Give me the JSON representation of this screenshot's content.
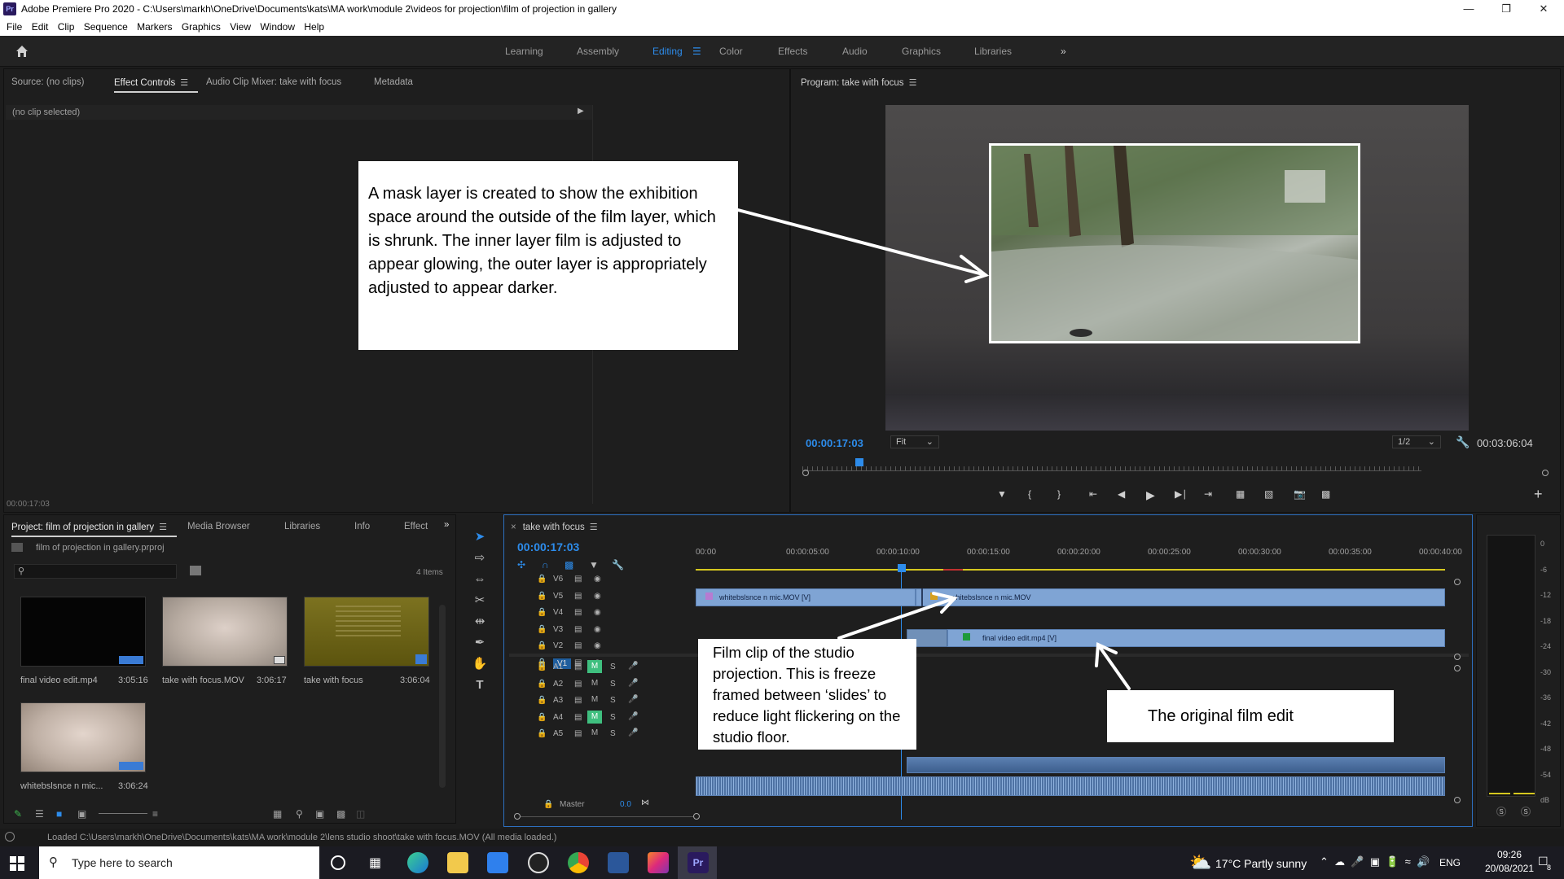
{
  "window": {
    "title": "Adobe Premiere Pro 2020 - C:\\Users\\markh\\OneDrive\\Documents\\kats\\MA work\\module 2\\videos for projection\\film of projection in gallery",
    "app_badge": "Pr"
  },
  "menu": [
    "File",
    "Edit",
    "Clip",
    "Sequence",
    "Markers",
    "Graphics",
    "View",
    "Window",
    "Help"
  ],
  "workspaces": [
    "Learning",
    "Assembly",
    "Editing",
    "Color",
    "Effects",
    "Audio",
    "Graphics",
    "Libraries"
  ],
  "workspace_active": "Editing",
  "source_panel": {
    "tabs": [
      "Source: (no clips)",
      "Effect Controls",
      "Audio Clip Mixer: take with focus",
      "Metadata"
    ],
    "no_clip": "(no clip selected)",
    "timecode": "00:00:17:03"
  },
  "program": {
    "title": "Program: take with focus",
    "timecode": "00:00:17:03",
    "fit": "Fit",
    "resolution": "1/2",
    "duration": "00:03:06:04",
    "playhead_fraction": 0.092
  },
  "project": {
    "tabs": [
      "Project: film of projection in gallery",
      "Media Browser",
      "Libraries",
      "Info",
      "Effect"
    ],
    "file": "film of projection in gallery.prproj",
    "items_count": "4 Items",
    "items": [
      {
        "name": "final video edit.mp4",
        "duration": "3:05:16",
        "color": "#050505"
      },
      {
        "name": "take with focus.MOV",
        "duration": "3:06:17",
        "color": "#b8aca2"
      },
      {
        "name": "take with focus",
        "duration": "3:06:04",
        "color": "#6e6418"
      },
      {
        "name": "whitebslsnce n mic...",
        "duration": "3:06:24",
        "color": "#c0b0a6"
      }
    ]
  },
  "timeline": {
    "sequence": "take with focus",
    "timecode": "00:00:17:03",
    "ruler": [
      "00:00",
      "00:00:05:00",
      "00:00:10:00",
      "00:00:15:00",
      "00:00:20:00",
      "00:00:25:00",
      "00:00:30:00",
      "00:00:35:00",
      "00:00:40:00"
    ],
    "video_tracks": [
      "V6",
      "V5",
      "V4",
      "V3",
      "V2",
      "V1"
    ],
    "audio_tracks": [
      "A1",
      "A2",
      "A3",
      "A4",
      "A5"
    ],
    "master_label": "Master",
    "master_value": "0.0",
    "clips": {
      "v5_a": "whitebslsnce n mic.MOV [V]",
      "v5_b": "whitebslsnce n mic.MOV",
      "v3": "final video edit.mp4 [V]"
    },
    "mute": "M",
    "solo": "S"
  },
  "meter_scale": [
    "0",
    "-6",
    "-12",
    "-18",
    "-24",
    "-30",
    "-36",
    "-42",
    "-48",
    "-54",
    "dB"
  ],
  "meter_buttons": [
    "S",
    "S"
  ],
  "annotations": {
    "mask": "A mask layer is created to show the exhibition space around the outside of the film layer, which is shrunk. The inner layer film is adjusted to appear glowing, the outer layer is appropriately adjusted to appear darker.",
    "freeze": "Film clip of the studio projection. This is freeze framed between ‘slides’ to reduce light flickering on the studio floor.",
    "original": "The original film edit"
  },
  "status": "Loaded C:\\Users\\markh\\OneDrive\\Documents\\kats\\MA work\\module 2\\lens studio shoot\\take with focus.MOV (All media loaded.)",
  "taskbar": {
    "search_placeholder": "Type here to search",
    "weather": "17°C  Partly sunny",
    "lang": "ENG",
    "time": "09:26",
    "date": "20/08/2021",
    "notif": "8"
  }
}
